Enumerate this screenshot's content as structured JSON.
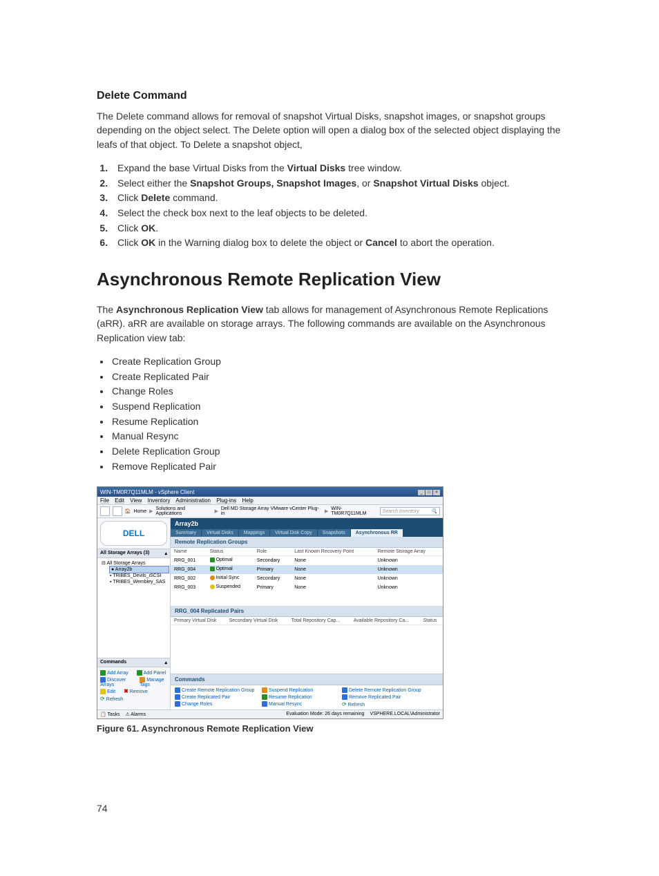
{
  "section1": {
    "heading": "Delete Command",
    "intro": "The Delete command allows for removal of snapshot Virtual Disks, snapshot images, or snapshot groups depending on the object select. The Delete option will open a dialog box of the selected object displaying the leafs of that object. To Delete a snapshot object,",
    "steps": {
      "s1a": "Expand the base Virtual Disks from the ",
      "s1b": "Virtual Disks",
      "s1c": " tree window.",
      "s2a": "Select either the ",
      "s2b": "Snapshot Groups, Snapshot Images",
      "s2c": ", or ",
      "s2d": "Snapshot Virtual Disks",
      "s2e": " object.",
      "s3a": "Click ",
      "s3b": "Delete",
      "s3c": " command.",
      "s4": "Select the check box next to the leaf objects to be deleted.",
      "s5a": "Click ",
      "s5b": "OK",
      "s5c": ".",
      "s6a": "Click ",
      "s6b": "OK",
      "s6c": " in the Warning dialog box to delete the object or ",
      "s6d": "Cancel",
      "s6e": " to abort the operation."
    }
  },
  "section2": {
    "heading": "Asynchronous Remote Replication View",
    "p1a": "The ",
    "p1b": "Asynchronous Replication View",
    "p1c": " tab allows for management of Asynchronous Remote Replications (aRR). aRR are available on storage arrays. The following commands are available on the Asynchronous Replication view tab:",
    "bullets": [
      "Create Replication Group",
      "Create Replicated Pair",
      "Change Roles",
      "Suspend Replication",
      "Resume Replication",
      "Manual Resync",
      "Delete Replication Group",
      "Remove Replicated Pair"
    ]
  },
  "screenshot": {
    "title": "WIN-TM0R7Q11MLM - vSphere Client",
    "menus": [
      "File",
      "Edit",
      "View",
      "Inventory",
      "Administration",
      "Plug-ins",
      "Help"
    ],
    "breadcrumb": {
      "home": "Home",
      "c1": "Solutions and Applications",
      "c2": "Dell MD Storage Array VMware vCenter Plug-in",
      "c3": "WIN-TM0R7Q11MLM"
    },
    "search_placeholder": "Search Inventory",
    "logo": "DELL",
    "tree_header": "All Storage Arrays (3)",
    "tree": {
      "root": "All Storage Arrays",
      "sel": "Array2b",
      "n2": "TRIBES_Devils_iSCSI",
      "n3": "TRIBES_Wembley_SAS"
    },
    "left_cmds_header": "Commands",
    "left_cmds": {
      "add_array": "Add Array",
      "add_panel": "Add Panel",
      "discover": "Discover Arrays",
      "manage_tags": "Manage Tags",
      "edit": "Edit",
      "remove": "Remove",
      "refresh": "Refresh"
    },
    "array_header": "Array2b",
    "tabs": [
      "Summary",
      "Virtual Disks",
      "Mappings",
      "Virtual Disk Copy",
      "Snapshots",
      "Asynchronous RR"
    ],
    "active_tab_index": 5,
    "groups_header": "Remote Replication Groups",
    "groups_cols": [
      "Name",
      "Status",
      "Role",
      "Last Known Recovery Point",
      "Remote Storage Array"
    ],
    "groups": [
      {
        "name": "RRG_001",
        "status": "Optimal",
        "status_icon": "ok",
        "role": "Secondary",
        "recovery": "None",
        "remote": "Unknown"
      },
      {
        "name": "RRG_004",
        "status": "Optimal",
        "status_icon": "ok",
        "role": "Primary",
        "recovery": "None",
        "remote": "Unknown",
        "sel": true
      },
      {
        "name": "RRG_002",
        "status": "Initial Sync",
        "status_icon": "sync",
        "role": "Secondary",
        "recovery": "None",
        "remote": "Unknown"
      },
      {
        "name": "RRG_003",
        "status": "Suspended",
        "status_icon": "susp",
        "role": "Primary",
        "recovery": "None",
        "remote": "Unknown"
      }
    ],
    "pairs_header": "RRG_004 Replicated Pairs",
    "pairs_cols": [
      "Primary Virtual Disk",
      "Secondary Virtual Disk",
      "Total Repository Cap...",
      "Available Repository Ca...",
      "Status"
    ],
    "right_cmds_header": "Commands",
    "right_cmds": {
      "create_group": "Create Remote Replication Group",
      "suspend": "Suspend Replication",
      "delete_group": "Delete Remote Replication Group",
      "create_pair": "Create Replicated Pair",
      "resume": "Resume Replication",
      "remove_pair": "Remove Replicated Pair",
      "change_roles": "Change Roles",
      "manual_resync": "Manual Resync",
      "refresh": "Refresh"
    },
    "statusbar": {
      "tasks": "Tasks",
      "alarms": "Alarms",
      "eval": "Evaluation Mode: 26 days remaining",
      "user": "VSPHERE.LOCAL\\Administrator"
    }
  },
  "figure_caption": "Figure 61. Asynchronous Remote Replication View",
  "page_number": "74"
}
